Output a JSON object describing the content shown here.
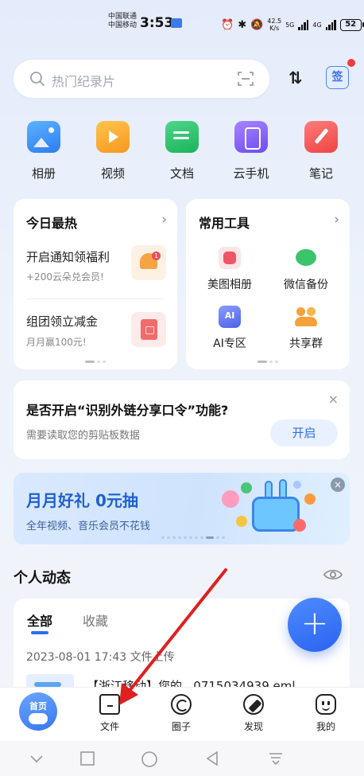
{
  "status_bar": {
    "carrier_1": "中国联通",
    "carrier_2": "中国移动",
    "time": "3:53",
    "net_speed_value": "42.5",
    "net_speed_unit": "K/s",
    "net_type_1": "5G",
    "net_type_2": "4G",
    "battery": "52"
  },
  "search": {
    "placeholder": "热门纪录片",
    "sort_icon": "⇅",
    "sign_label": "签"
  },
  "quick_entries": [
    {
      "label": "相册",
      "icon": "album-icon"
    },
    {
      "label": "视频",
      "icon": "video-icon"
    },
    {
      "label": "文档",
      "icon": "document-icon"
    },
    {
      "label": "云手机",
      "icon": "cloud-phone-icon"
    },
    {
      "label": "笔记",
      "icon": "note-icon"
    }
  ],
  "hot_card": {
    "title": "今日最热",
    "arrow": "›",
    "items": [
      {
        "title": "开启通知领福利",
        "subtitle": "+200云朵兑会员!",
        "badge": "1"
      },
      {
        "title": "组团领立减金",
        "subtitle": "月月赢100元!"
      }
    ]
  },
  "tools_card": {
    "title": "常用工具",
    "arrow": "›",
    "items": [
      {
        "label": "美图相册"
      },
      {
        "label": "微信备份"
      },
      {
        "label": "AI专区"
      },
      {
        "label": "共享群"
      }
    ]
  },
  "clipboard_banner": {
    "title": "是否开启“识别外链分享口令”功能?",
    "subtitle": "需要读取您的剪贴板数据",
    "button": "开启",
    "close": "×"
  },
  "promo_banner": {
    "title": "月月好礼 0元抽",
    "subtitle": "全年视频、音乐会员不花钱",
    "close": "×"
  },
  "feed": {
    "section_title": "个人动态",
    "tabs": [
      {
        "label": "全部"
      },
      {
        "label": "收藏"
      }
    ],
    "time_text": "2023-08-01 17:43  文件上传",
    "item_text": "【浙江移动】您的...0715034939.eml"
  },
  "fab_label": "+",
  "tab_bar": {
    "home": "首页",
    "items": [
      {
        "label": "文件",
        "icon": "folder-icon"
      },
      {
        "label": "圈子",
        "icon": "circle-icon"
      },
      {
        "label": "发现",
        "icon": "compass-icon"
      },
      {
        "label": "我的",
        "icon": "profile-icon"
      }
    ]
  },
  "colors": {
    "accent": "#2f6cf3",
    "annotation_arrow": "#e02020"
  }
}
